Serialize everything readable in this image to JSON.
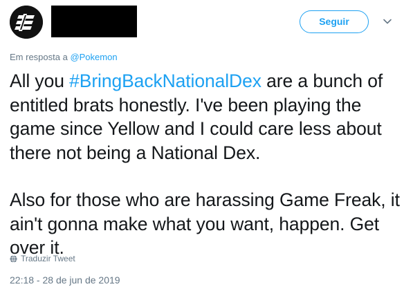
{
  "header": {
    "follow_label": "Seguir",
    "avatar_icon": "logo-avatar",
    "menu_icon": "chevron-down-icon"
  },
  "reply_context": {
    "prefix": "Em resposta a ",
    "mention": "@Pokemon"
  },
  "tweet": {
    "line1_before": "All you ",
    "hashtag": "#BringBackNationalDex",
    "line1_after": " are a bunch of entitled brats honestly. I've been playing the game since Yellow and I could care less about there not being a National Dex.",
    "paragraph2": "Also for those who are harassing Game Freak, it ain't gonna make what you want, happen. Get over it."
  },
  "footer": {
    "translate_label": "Traduzir Tweet",
    "translate_icon": "globe-icon",
    "timestamp": "22:18 - 28 de jun de 2019"
  },
  "colors": {
    "accent": "#1da1f2",
    "muted": "#657786",
    "text": "#14171a"
  }
}
